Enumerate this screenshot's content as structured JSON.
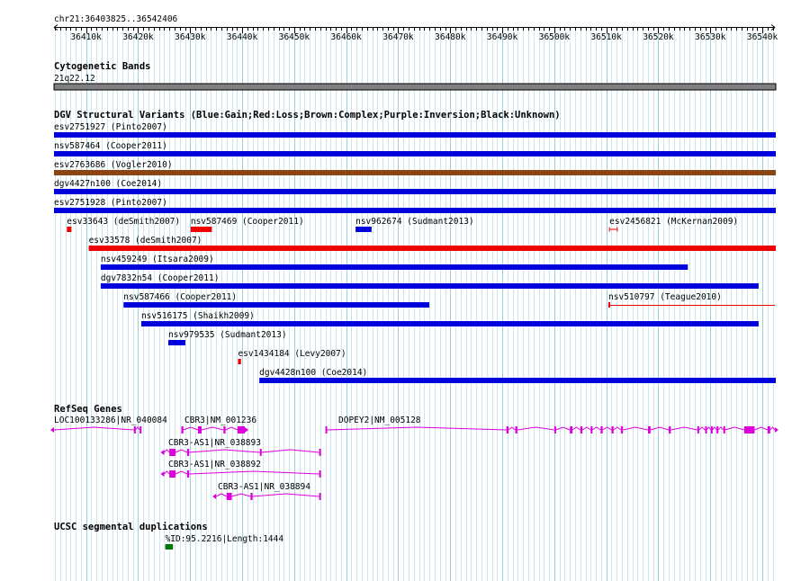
{
  "region": "chr21:36403825..36542406",
  "ruler": {
    "start": 36403825,
    "end": 36542406,
    "ticks": [
      "36410k",
      "36420k",
      "36430k",
      "36440k",
      "36450k",
      "36460k",
      "36470k",
      "36480k",
      "36490k",
      "36500k",
      "36510k",
      "36520k",
      "36530k",
      "36540k"
    ]
  },
  "tracks": {
    "cytobands": {
      "title": "Cytogenetic Bands",
      "band_label": "21q22.12",
      "band_color": "#7f7f7f"
    },
    "dgv": {
      "title": "DGV Structural Variants (Blue:Gain;Red:Loss;Brown:Complex;Purple:Inversion;Black:Unknown)",
      "colors": {
        "gain": "#0000dd",
        "loss": "#ee0000",
        "complex": "#8b4513",
        "inversion": "#800080",
        "unknown": "#000000"
      },
      "features": [
        {
          "label": "esv2751927 (Pinto2007)",
          "start": 36403825,
          "end": 36542406,
          "type": "gain"
        },
        {
          "label": "nsv587464 (Cooper2011)",
          "start": 36403825,
          "end": 36542406,
          "type": "gain"
        },
        {
          "label": "esv2763686 (Vogler2010)",
          "start": 36403825,
          "end": 36542406,
          "type": "complex"
        },
        {
          "label": "dgv4427n100 (Coe2014)",
          "start": 36403825,
          "end": 36542406,
          "type": "gain"
        },
        {
          "label": "esv2751928 (Pinto2007)",
          "start": 36403825,
          "end": 36542406,
          "type": "gain"
        },
        {
          "label": "esv33643 (deSmith2007)",
          "start": 36406300,
          "end": 36407000,
          "type": "loss"
        },
        {
          "label": "nsv587469 (Cooper2011)",
          "start": 36430100,
          "end": 36434000,
          "type": "loss"
        },
        {
          "label": "nsv962674 (Sudmant2013)",
          "start": 36461800,
          "end": 36464700,
          "type": "gain"
        },
        {
          "label": "esv2456821 (McKernan2009)",
          "start": 36510600,
          "end": 36512100,
          "type": "loss_bracket"
        },
        {
          "label": "esv33578 (deSmith2007)",
          "start": 36410500,
          "end": 36542406,
          "type": "loss"
        },
        {
          "label": "nsv459249 (Itsara2009)",
          "start": 36412800,
          "end": 36525500,
          "type": "gain"
        },
        {
          "label": "dgv7832n54 (Cooper2011)",
          "start": 36412800,
          "end": 36539100,
          "type": "gain"
        },
        {
          "label": "nsv587466 (Cooper2011)",
          "start": 36417200,
          "end": 36475800,
          "type": "gain"
        },
        {
          "label": "nsv510797 (Teague2010)",
          "start": 36510400,
          "end": 36542406,
          "type": "loss_thin"
        },
        {
          "label": "nsv516175 (Shaikh2009)",
          "start": 36420600,
          "end": 36539100,
          "type": "gain"
        },
        {
          "label": "nsv979535 (Sudmant2013)",
          "start": 36425800,
          "end": 36428900,
          "type": "gain"
        },
        {
          "label": "esv1434184 (Levy2007)",
          "start": 36439200,
          "end": 36439600,
          "type": "loss"
        },
        {
          "label": "dgv4428n100 (Coe2014)",
          "start": 36443300,
          "end": 36542406,
          "type": "gain"
        }
      ]
    },
    "refseq": {
      "title": "RefSeq Genes",
      "color": "#dd00dd",
      "genes": [
        {
          "label": "LOC100133286|NR_040084",
          "start": 36403825,
          "end": 36420600,
          "strand": "-",
          "exons": [
            [
              36419200,
              36419500
            ],
            [
              36420300,
              36420600
            ]
          ]
        },
        {
          "label": "CBR3|NM_001236",
          "start": 36428300,
          "end": 36440500,
          "strand": "+",
          "exons": [
            [
              36428300,
              36428700
            ],
            [
              36431500,
              36432200
            ],
            [
              36436400,
              36436800
            ],
            [
              36439100,
              36440500
            ]
          ]
        },
        {
          "label": "DOPEY2|NM_005128",
          "start": 36456000,
          "end": 36542406,
          "strand": "+",
          "exons": [
            [
              36456000,
              36456300
            ],
            [
              36490800,
              36491200
            ],
            [
              36492500,
              36492900
            ],
            [
              36500000,
              36500300
            ],
            [
              36503000,
              36503500
            ],
            [
              36505000,
              36505400
            ],
            [
              36507000,
              36507300
            ],
            [
              36508900,
              36509300
            ],
            [
              36511000,
              36511400
            ],
            [
              36512800,
              36513200
            ],
            [
              36518000,
              36518500
            ],
            [
              36522000,
              36522400
            ],
            [
              36527500,
              36527800
            ],
            [
              36529000,
              36529300
            ],
            [
              36530100,
              36530400
            ],
            [
              36531200,
              36531500
            ],
            [
              36532500,
              36532800
            ],
            [
              36536500,
              36538500
            ],
            [
              36541000,
              36541500
            ]
          ]
        },
        {
          "label": "CBR3-AS1|NR_038893",
          "start": 36425000,
          "end": 36455100,
          "strand": "-",
          "exons": [
            [
              36426000,
              36427200
            ],
            [
              36429400,
              36429800
            ],
            [
              36443400,
              36443700
            ],
            [
              36454800,
              36455100
            ]
          ]
        },
        {
          "label": "CBR3-AS1|NR_038892",
          "start": 36425000,
          "end": 36455100,
          "strand": "-",
          "exons": [
            [
              36426000,
              36427200
            ],
            [
              36429400,
              36429800
            ],
            [
              36454800,
              36455100
            ]
          ]
        },
        {
          "label": "CBR3-AS1|NR_038894",
          "start": 36435000,
          "end": 36455100,
          "strand": "-",
          "exons": [
            [
              36437000,
              36438000
            ],
            [
              36441600,
              36442000
            ],
            [
              36454800,
              36455100
            ]
          ]
        }
      ]
    },
    "segdups": {
      "title": "UCSC segmental duplications",
      "color": "#007700",
      "features": [
        {
          "label": "%ID:95.2216|Length:1444",
          "start": 36425200,
          "end": 36426700
        }
      ]
    }
  }
}
